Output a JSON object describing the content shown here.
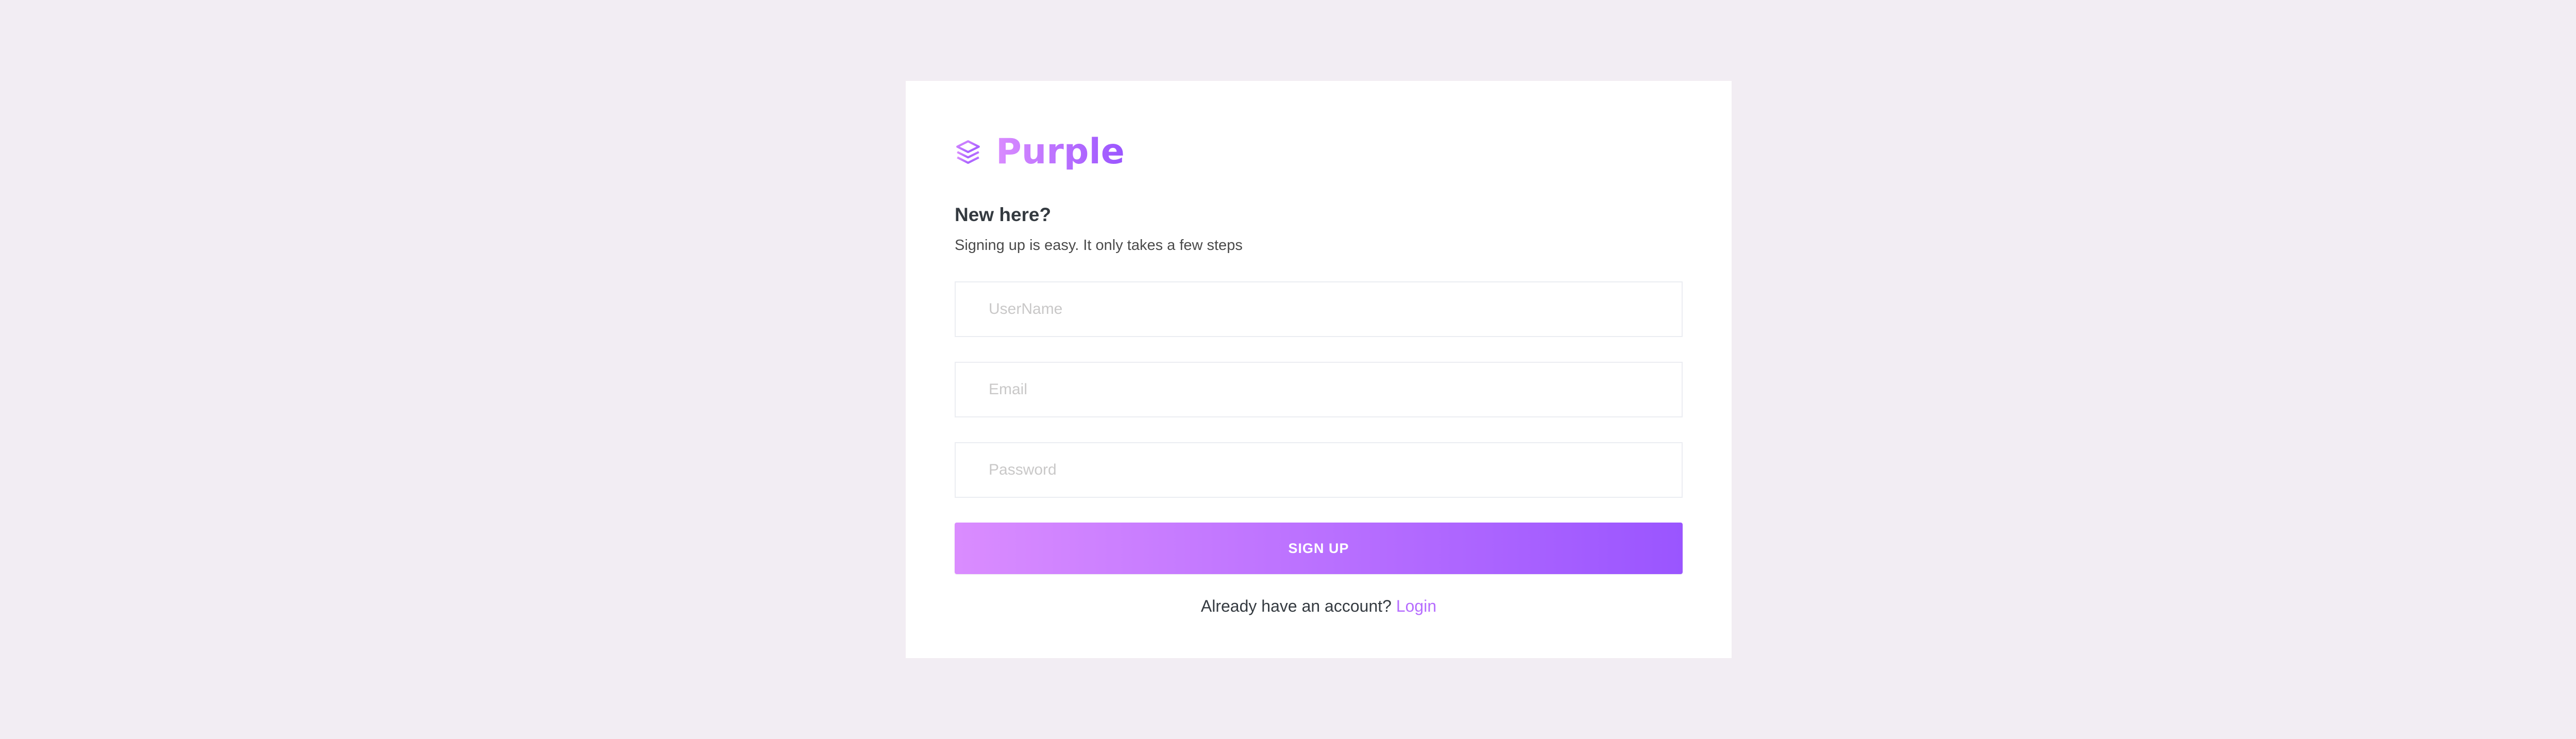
{
  "brand": {
    "name": "Purple",
    "icon": "layers-icon"
  },
  "form": {
    "heading": "New here?",
    "subheading": "Signing up is easy. It only takes a few steps",
    "username_placeholder": "UserName",
    "email_placeholder": "Email",
    "password_placeholder": "Password",
    "submit_label": "SIGN UP",
    "login_prompt": "Already have an account?",
    "login_link": "Login"
  },
  "colors": {
    "background": "#f2edf3",
    "gradient_start": "#da8cff",
    "gradient_end": "#9a55ff",
    "link": "#b66dff"
  }
}
